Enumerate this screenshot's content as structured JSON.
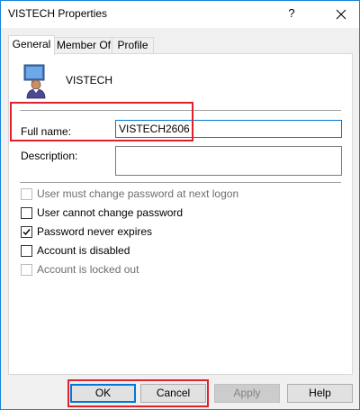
{
  "window": {
    "title": "VISTECH Properties",
    "help_glyph": "?",
    "close_glyph": "close"
  },
  "tabs": [
    {
      "label": "General",
      "active": true
    },
    {
      "label": "Member Of",
      "active": false
    },
    {
      "label": "Profile",
      "active": false
    }
  ],
  "general": {
    "user_icon": "user-computer-icon",
    "user_name": "VISTECH",
    "full_name_label": "Full name:",
    "full_name_value": "VISTECH2606",
    "description_label": "Description:",
    "description_value": ""
  },
  "options": [
    {
      "label": "User must change password at next logon",
      "checked": false,
      "disabled": true
    },
    {
      "label": "User cannot change password",
      "checked": false,
      "disabled": false
    },
    {
      "label": "Password never expires",
      "checked": true,
      "disabled": false
    },
    {
      "label": "Account is disabled",
      "checked": false,
      "disabled": false
    },
    {
      "label": "Account is locked out",
      "checked": false,
      "disabled": true
    }
  ],
  "buttons": {
    "ok": "OK",
    "cancel": "Cancel",
    "apply": "Apply",
    "help": "Help"
  },
  "colors": {
    "highlight": "#e0212c",
    "accent": "#0078d7"
  }
}
